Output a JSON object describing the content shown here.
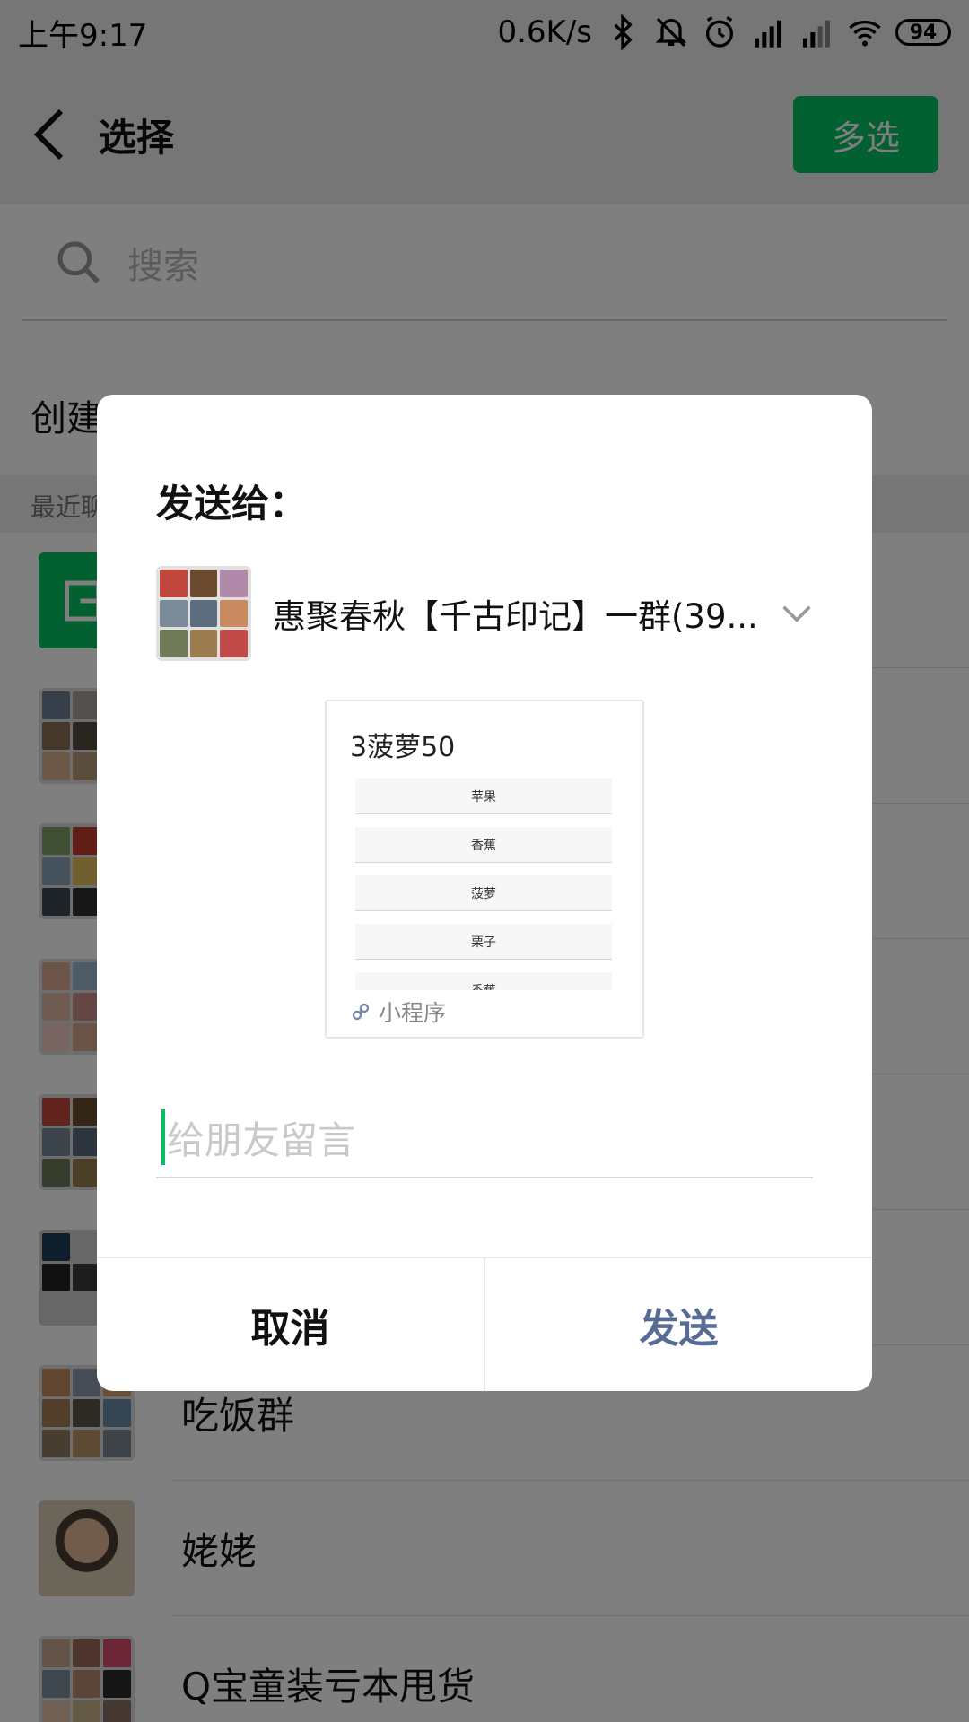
{
  "status_bar": {
    "time": "上午9:17",
    "net_speed": "0.6K/s",
    "battery": "94"
  },
  "header": {
    "title": "选择",
    "multi_select": "多选"
  },
  "search": {
    "placeholder": "搜索"
  },
  "create_row": {
    "label": "创建新聊天"
  },
  "section": {
    "label": "最近聊天"
  },
  "contacts": [
    {
      "name": ""
    },
    {
      "name": ""
    },
    {
      "name": ""
    },
    {
      "name": ""
    },
    {
      "name": ""
    },
    {
      "name": ""
    },
    {
      "name": "吃饭群"
    },
    {
      "name": "姥姥"
    },
    {
      "name": "Q宝童装亏本甩货"
    }
  ],
  "dialog": {
    "title": "发送给：",
    "recipient": "惠聚春秋【千古印记】一群(39...",
    "card": {
      "title": "3菠萝50",
      "items": [
        "苹果",
        "香蕉",
        "菠萝",
        "栗子",
        "香蕉"
      ],
      "source": "小程序"
    },
    "message_placeholder": "给朋友留言",
    "cancel": "取消",
    "send": "发送"
  },
  "colors": {
    "accent_green": "#07c160",
    "send_blue": "#576b95",
    "overlay": "rgba(0,0,0,0.5)"
  }
}
